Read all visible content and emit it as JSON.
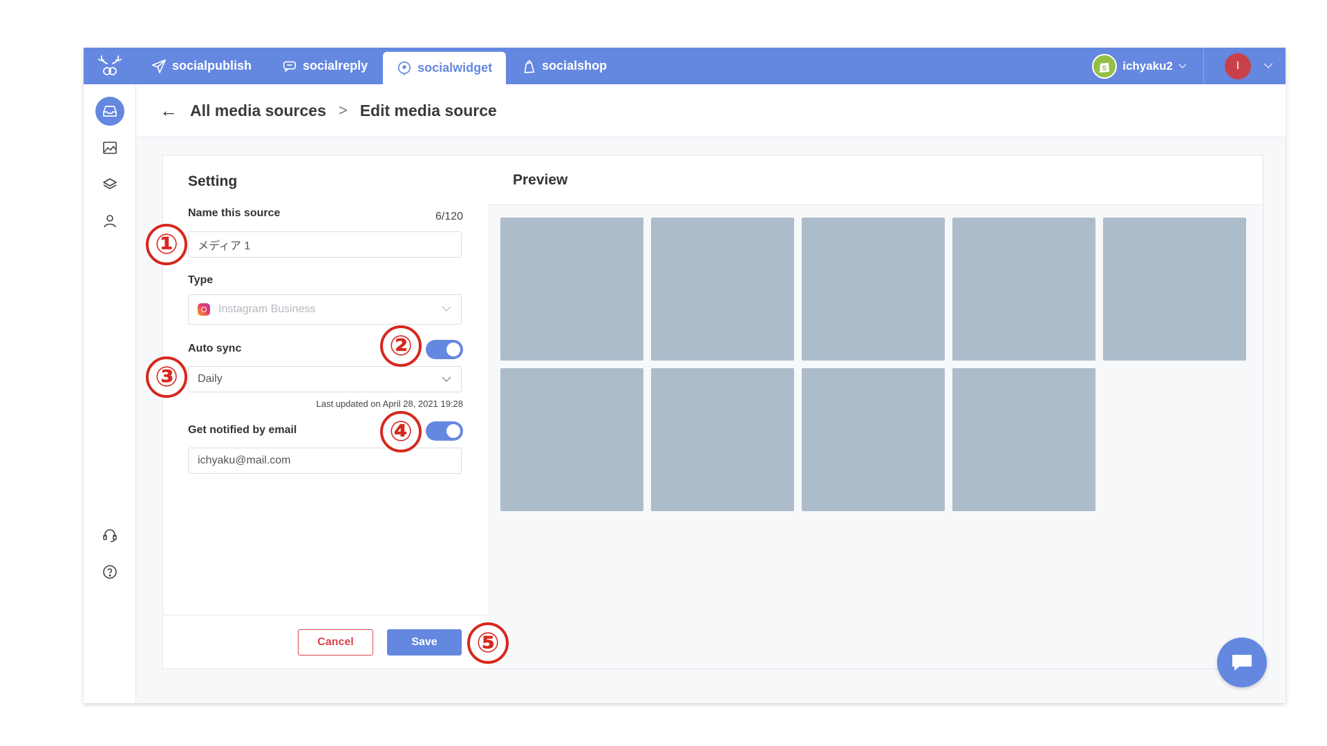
{
  "topbar": {
    "tabs": [
      {
        "label": "socialpublish",
        "icon": "paper-plane-icon"
      },
      {
        "label": "socialreply",
        "icon": "chat-reply-icon"
      },
      {
        "label": "socialwidget",
        "icon": "widget-pin-icon",
        "active": true
      },
      {
        "label": "socialshop",
        "icon": "shopping-bag-icon"
      }
    ],
    "account_name": "ichyaku2",
    "user_initial": "I"
  },
  "sidebar": {
    "items": [
      {
        "icon": "inbox-icon",
        "active": true
      },
      {
        "icon": "image-icon"
      },
      {
        "icon": "layers-icon"
      },
      {
        "icon": "user-icon"
      },
      {
        "icon": "support-headset-icon"
      },
      {
        "icon": "help-icon"
      }
    ]
  },
  "breadcrumb": {
    "back": "←",
    "parent": "All media sources",
    "separator": ">",
    "current": "Edit media source"
  },
  "settings": {
    "title": "Setting",
    "name_label": "Name this source",
    "name_counter": "6/120",
    "name_value": "メディア 1",
    "type_label": "Type",
    "type_value": "Instagram Business",
    "autosync_label": "Auto sync",
    "autosync_enabled": true,
    "autosync_frequency": "Daily",
    "last_updated": "Last updated on April 28, 2021 19:28",
    "notify_label": "Get notified by email",
    "notify_enabled": true,
    "notify_email": "ichyaku@mail.com",
    "cancel_label": "Cancel",
    "save_label": "Save"
  },
  "preview": {
    "title": "Preview",
    "tile_count": 9
  },
  "markers": [
    "①",
    "②",
    "③",
    "④",
    "⑤"
  ],
  "colors": {
    "primary": "#6487e0",
    "danger": "#d8454e",
    "marker": "#d6281e",
    "tile": "#adbccb"
  }
}
